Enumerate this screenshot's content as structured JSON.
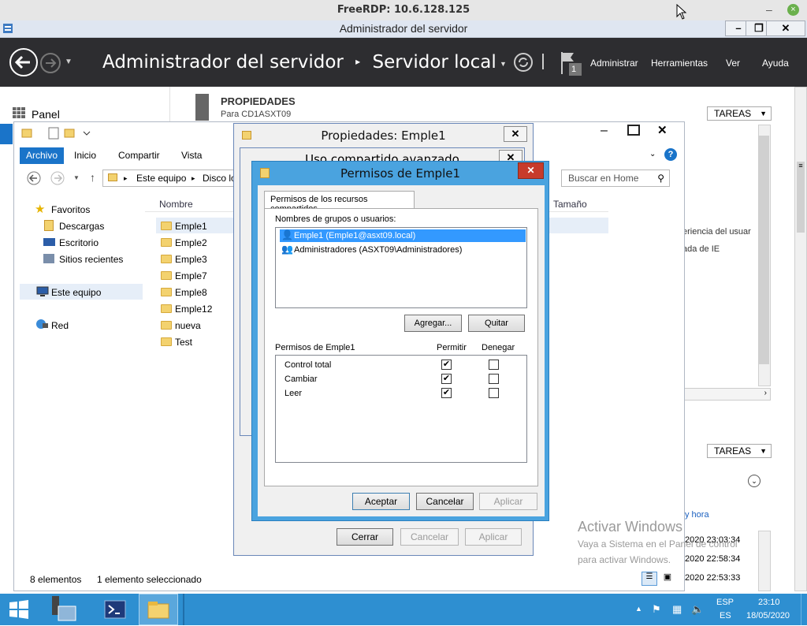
{
  "rdp": {
    "title": "FreeRDP: 10.6.128.125"
  },
  "app": {
    "window_title": "Administrador del servidor",
    "crumb_root": "Administrador del servidor",
    "crumb_page": "Servidor local",
    "notif_count": "1",
    "menu": [
      "Administrar",
      "Herramientas",
      "Ver",
      "Ayuda"
    ],
    "panel_label": "Panel"
  },
  "props": {
    "heading": "PROPIEDADES",
    "subheading": "Para CD1ASXT09",
    "tareas": "TAREAS",
    "side_text1": "eriencia del usuar",
    "side_text2": "ada de IE",
    "events_link": "y hora",
    "times": [
      "2020 23:03:34",
      "2020 22:58:34",
      "2020 22:53:33"
    ]
  },
  "explorer": {
    "tabs": [
      "Archivo",
      "Inicio",
      "Compartir",
      "Vista"
    ],
    "address": [
      "Este equipo",
      "Disco lo"
    ],
    "search_placeholder": "Buscar en Home",
    "col_name": "Nombre",
    "col_size": "Tamaño",
    "nav": {
      "favoritos": "Favoritos",
      "descargas": "Descargas",
      "escritorio": "Escritorio",
      "recientes": "Sitios recientes",
      "equipo": "Este equipo",
      "red": "Red"
    },
    "files": [
      "Emple1",
      "Emple2",
      "Emple3",
      "Emple7",
      "Emple8",
      "Emple12",
      "nueva",
      "Test"
    ],
    "status_count": "8 elementos",
    "status_sel": "1 elemento seleccionado"
  },
  "props_dialog": {
    "title": "Propiedades: Emple1",
    "buttons": [
      "Cerrar",
      "Cancelar",
      "Aplicar"
    ]
  },
  "adv_dialog": {
    "title": "Uso compartido avanzado"
  },
  "perm_dialog": {
    "title": "Permisos de Emple1",
    "tab": "Permisos de los recursos compartidos",
    "users_label": "Nombres de grupos o usuarios:",
    "users": [
      "Emple1 (Emple1@asxt09.local)",
      "Administradores (ASXT09\\Administradores)"
    ],
    "add_btn": "Agregar...",
    "remove_btn": "Quitar",
    "perm_label": "Permisos de Emple1",
    "col_allow": "Permitir",
    "col_deny": "Denegar",
    "perms": [
      {
        "name": "Control total",
        "allow": true,
        "deny": false
      },
      {
        "name": "Cambiar",
        "allow": true,
        "deny": false
      },
      {
        "name": "Leer",
        "allow": true,
        "deny": false
      }
    ],
    "ok": "Aceptar",
    "cancel": "Cancelar",
    "apply": "Aplicar"
  },
  "watermark": {
    "line1": "Activar Windows",
    "line2": "Vaya a Sistema en el Panel de control",
    "line3": "para activar Windows."
  },
  "taskbar": {
    "lang1": "ESP",
    "lang2": "ES",
    "time": "23:10",
    "date": "18/05/2020"
  },
  "colors": {
    "accent": "#1a74c9",
    "header": "#2d2d30",
    "taskbar": "#2e8fd1",
    "dialog_border": "#4aa3df"
  }
}
